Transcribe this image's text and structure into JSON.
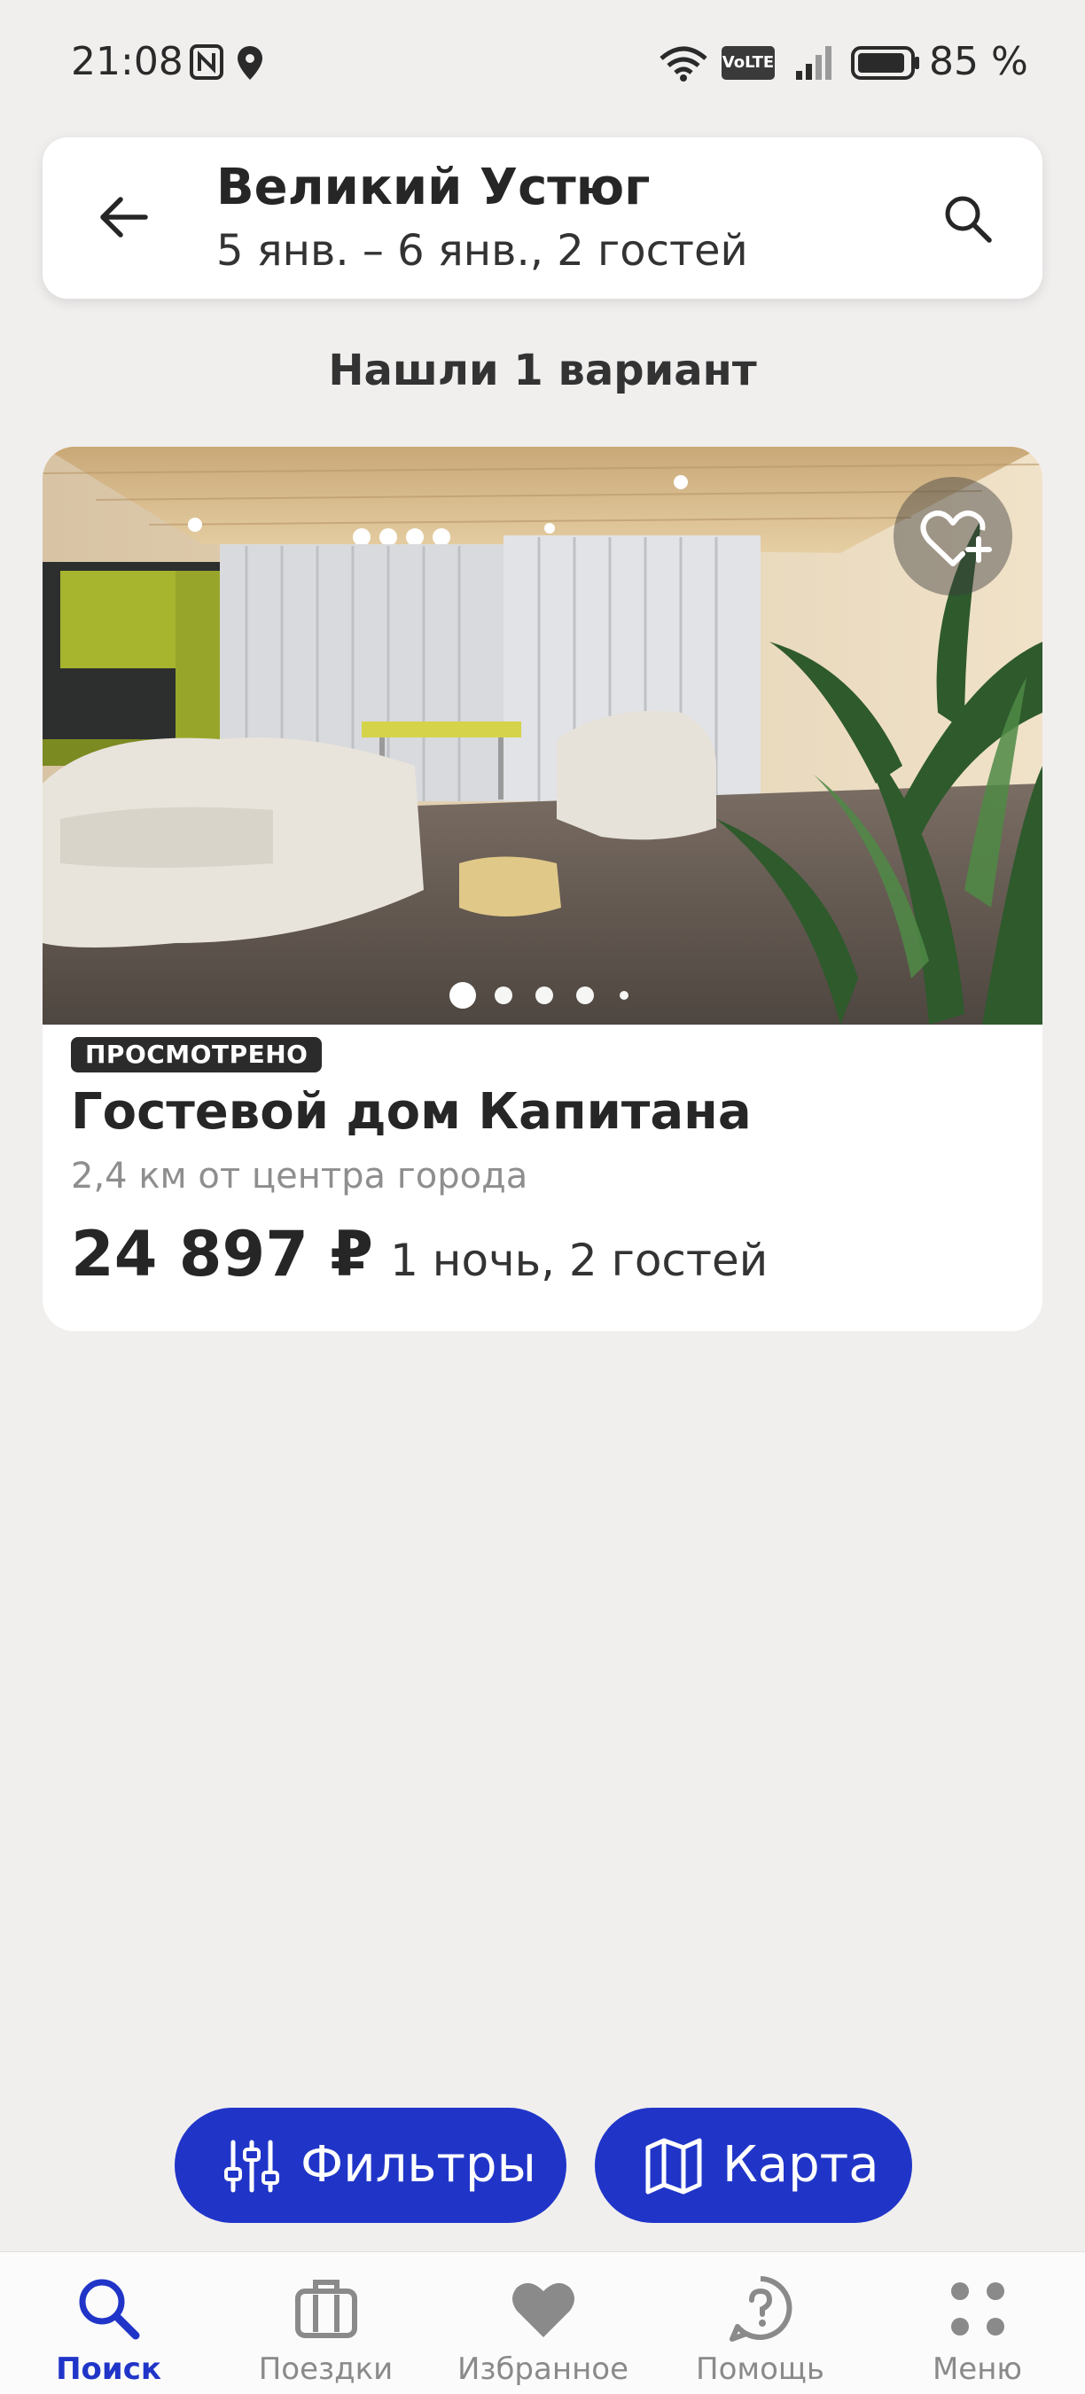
{
  "status_bar": {
    "time": "21:08",
    "battery_pct": "85 %",
    "volte": "VoLTE",
    "icons": [
      "nfc-icon",
      "location-icon",
      "wifi-icon",
      "volte-icon",
      "signal-icon",
      "battery-icon"
    ]
  },
  "header": {
    "title": "Великий Устюг",
    "subtitle": "5 янв. – 6 янв., 2 гостей"
  },
  "results": {
    "count_text": "Нашли 1 вариант"
  },
  "listings": [
    {
      "badge": "ПРОСМОТРЕНО",
      "name": "Гостевой дом Капитана",
      "distance": "2,4 км от центра города",
      "price": "24 897 ₽",
      "price_note": "1 ночь, 2 гостей",
      "photo_index": 0,
      "photo_count": 5
    }
  ],
  "actions": {
    "filters_label": "Фильтры",
    "map_label": "Карта"
  },
  "bottom_nav": [
    {
      "label": "Поиск",
      "icon": "search-icon",
      "active": true
    },
    {
      "label": "Поездки",
      "icon": "suitcase-icon",
      "active": false
    },
    {
      "label": "Избранное",
      "icon": "heart-icon",
      "active": false
    },
    {
      "label": "Помощь",
      "icon": "help-icon",
      "active": false
    },
    {
      "label": "Меню",
      "icon": "menu-dots-icon",
      "active": false
    }
  ],
  "colors": {
    "accent": "#2035c8",
    "background": "#f1efee",
    "badge": "#2b2b2b",
    "muted_text": "#8e8e8e"
  }
}
